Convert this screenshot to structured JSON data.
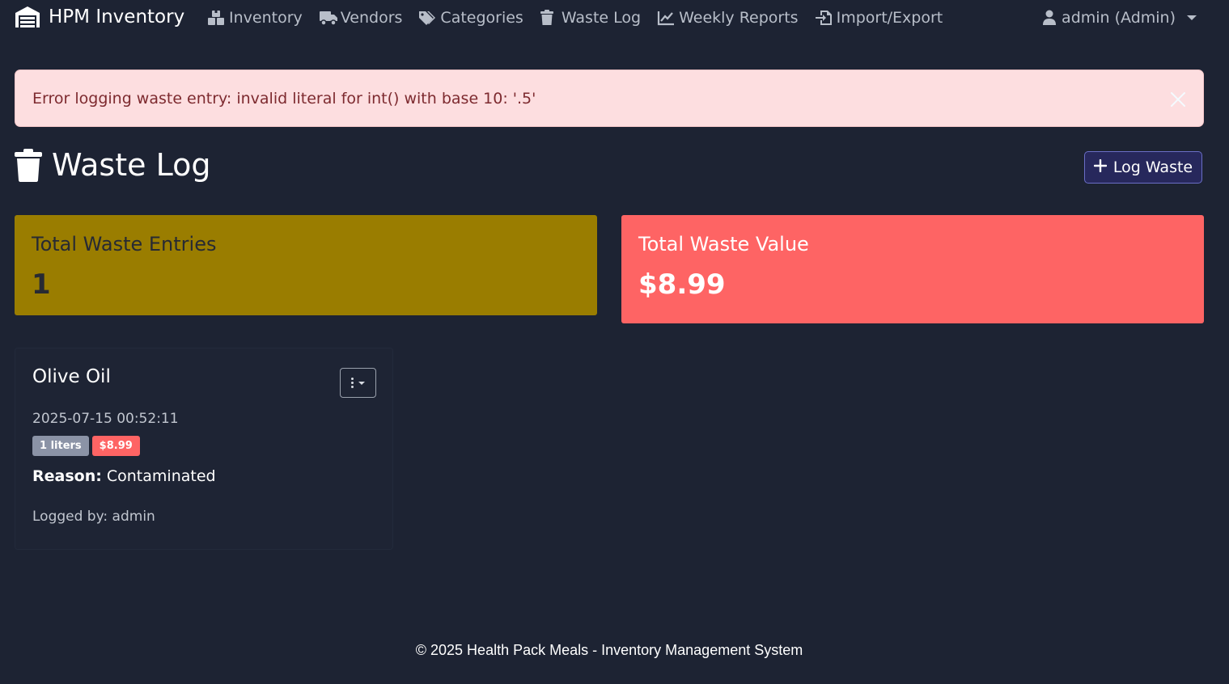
{
  "navbar": {
    "brand": "HPM Inventory",
    "brand_icon": "warehouse-icon",
    "links": [
      {
        "label": "Inventory",
        "icon": "boxes-icon"
      },
      {
        "label": "Vendors",
        "icon": "truck-icon"
      },
      {
        "label": "Categories",
        "icon": "tags-icon"
      },
      {
        "label": "Waste Log",
        "icon": "trash-icon"
      },
      {
        "label": "Weekly Reports",
        "icon": "chart-line-icon"
      },
      {
        "label": "Import/Export",
        "icon": "file-import-icon"
      }
    ],
    "user": "admin (Admin)",
    "user_icon": "user-icon"
  },
  "alert": {
    "message": "Error logging waste entry: invalid literal for int() with base 10: '.5'",
    "type": "danger"
  },
  "page": {
    "title": "Waste Log",
    "title_icon": "trash-icon",
    "log_button": "Log Waste"
  },
  "stats": {
    "entries_label": "Total Waste Entries",
    "entries_value": "1",
    "value_label": "Total Waste Value",
    "value_value": "$8.99"
  },
  "entries": [
    {
      "item": "Olive Oil",
      "timestamp": "2025-07-15 00:52:11",
      "quantity": "1 liters",
      "cost": "$8.99",
      "reason_label": "Reason:",
      "reason": "Contaminated",
      "logged_by": "Logged by: admin"
    }
  ],
  "footer": {
    "text": "© 2025 Health Pack Meals - Inventory Management System"
  },
  "colors": {
    "background": "#1d2333",
    "alert_bg": "#fddee0",
    "alert_text": "#7d2a2f",
    "warning": "#9a7d00",
    "danger": "#fe6464",
    "primary_outline": "#6a6ec6",
    "badge_secondary": "#8b93a6"
  }
}
